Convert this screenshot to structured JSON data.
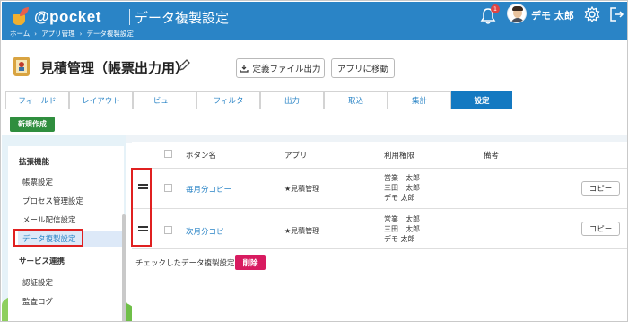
{
  "header": {
    "logo_text": "@pocket",
    "title": "データ複製設定",
    "breadcrumb": [
      "ホーム",
      "アプリ管理",
      "データ複製設定"
    ],
    "notification_count": "1",
    "user_name": "デモ 太郎"
  },
  "page": {
    "title": "見積管理（帳票出力用）",
    "export_label": "定義ファイル出力",
    "goto_app_label": "アプリに移動"
  },
  "tabs": [
    {
      "label": "フィールド",
      "active": false
    },
    {
      "label": "レイアウト",
      "active": false
    },
    {
      "label": "ビュー",
      "active": false
    },
    {
      "label": "フィルタ",
      "active": false
    },
    {
      "label": "出力",
      "active": false
    },
    {
      "label": "取込",
      "active": false
    },
    {
      "label": "集計",
      "active": false
    },
    {
      "label": "設定",
      "active": true
    }
  ],
  "new_button": "新規作成",
  "sidebar": {
    "section1": "拡張機能",
    "items1": [
      "帳票設定",
      "プロセス管理設定",
      "メール配信設定",
      "データ複製設定"
    ],
    "current": "データ複製設定",
    "section2": "サービス連携",
    "items2": [
      "認証設定",
      "監査ログ"
    ]
  },
  "table": {
    "columns": [
      "ボタン名",
      "アプリ",
      "利用権限",
      "備考"
    ],
    "rows": [
      {
        "button_name": "毎月分コピー",
        "app": "★見積管理",
        "permissions": [
          "営業　太郎",
          "三田　太郎",
          "デモ 太郎"
        ],
        "note": "",
        "copy_label": "コピー"
      },
      {
        "button_name": "次月分コピー",
        "app": "★見積管理",
        "permissions": [
          "営業　太郎",
          "三田　太郎",
          "デモ 太郎"
        ],
        "note": "",
        "copy_label": "コピー"
      }
    ]
  },
  "footer": {
    "text": "チェックしたデータ複製設定を",
    "delete_label": "削除"
  },
  "colors": {
    "header_blue": "#2a84c6",
    "active_tab": "#1479c1",
    "new_button": "#2f8e3e",
    "delete_button": "#d81b60",
    "annotation_red": "#e02020"
  }
}
